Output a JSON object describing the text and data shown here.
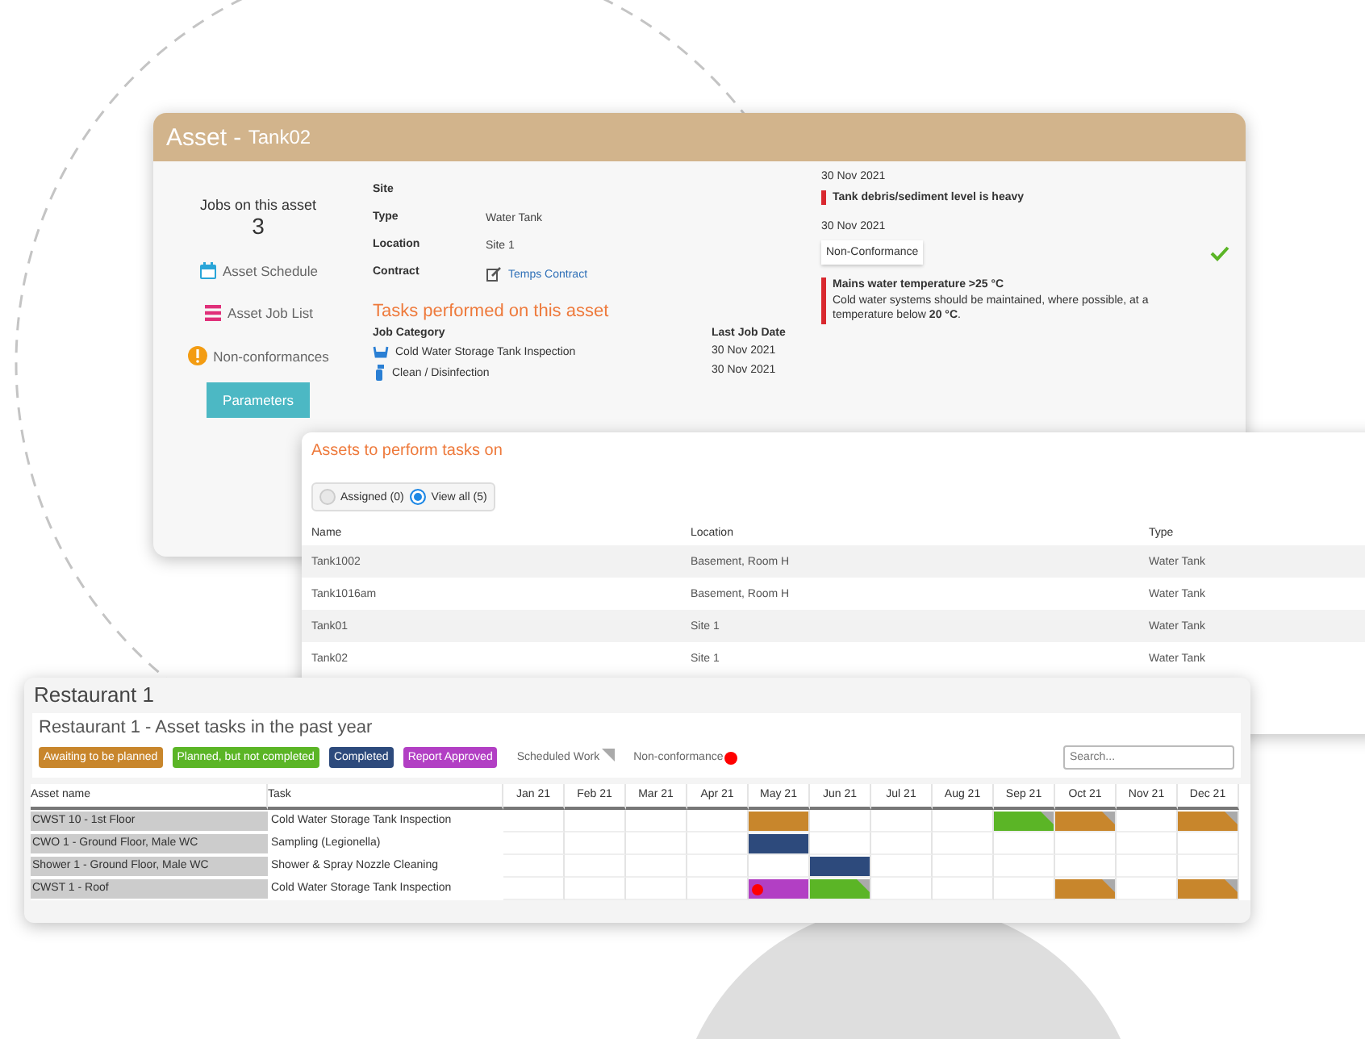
{
  "asset_window": {
    "title": "Asset -",
    "subtitle": "Tank02",
    "jobs_label": "Jobs on this asset",
    "jobs_count": "3",
    "links": [
      {
        "label": "Asset Schedule",
        "kind": "calendar"
      },
      {
        "label": "Asset Job List",
        "kind": "list"
      },
      {
        "label": "Non-conformances",
        "kind": "warning"
      }
    ],
    "button": "Parameters",
    "fields": [
      {
        "label": "Site",
        "kind": "text"
      },
      {
        "label": "Type",
        "value": "Water Tank",
        "kind": "text"
      },
      {
        "label": "Location",
        "value": "Site 1",
        "kind": "text"
      },
      {
        "label": "Contract",
        "value": "Temps Contract",
        "kind": "link"
      }
    ],
    "tasks": {
      "heading": "Tasks performed on this asset",
      "columns": [
        "Job Category",
        "Last Job Date"
      ],
      "rows": [
        {
          "category": "Cold Water Storage Tank Inspection",
          "date": "30 Nov 2021",
          "kind": "inspection"
        },
        {
          "category": "Clean / Disinfection",
          "date": "30 Nov 2021",
          "kind": "clean"
        }
      ]
    },
    "notes": [
      {
        "date": "30 Nov 2021",
        "title": "Tank debris/sediment level is heavy",
        "resolved": false
      },
      {
        "date": "30 Nov 2021",
        "badge": "Non-Conformance",
        "resolved": true,
        "title": "Mains water temperature >25 °C",
        "text": "Cold water systems should be maintained, where possible, at a temperature below **20 °C**."
      }
    ]
  },
  "assets_panel": {
    "title": "Assets to perform tasks on",
    "filters": [
      {
        "label": "Assigned (0)",
        "selected": false
      },
      {
        "label": "View all (5)",
        "selected": true
      }
    ],
    "columns": [
      "Name",
      "Location",
      "Type"
    ],
    "rows": [
      [
        "Tank1002",
        "Basement, Room H",
        "Water Tank"
      ],
      [
        "Tank1016am",
        "Basement, Room H",
        "Water Tank"
      ],
      [
        "Tank01",
        "Site 1",
        "Water Tank"
      ],
      [
        "Tank02",
        "Site 1",
        "Water Tank"
      ]
    ]
  },
  "restaurant": {
    "title": "Restaurant 1",
    "subtitle": "Restaurant 1 - Asset tasks in the past year",
    "legend": [
      {
        "label": "Awaiting to be planned",
        "color": "#c8862c"
      },
      {
        "label": "Planned, but not completed",
        "color": "#5bb526"
      },
      {
        "label": "Completed",
        "color": "#2d4a7c"
      },
      {
        "label": "Report Approved",
        "color": "#b23fc4"
      }
    ],
    "markers": [
      {
        "label": "Scheduled Work",
        "kind": "scheduled"
      },
      {
        "label": "Non-conformance",
        "kind": "nonconformance"
      }
    ],
    "search": {
      "placeholder": "Search..."
    },
    "columns": [
      "Asset name",
      "Task",
      "Jan 21",
      "Feb 21",
      "Mar 21",
      "Apr 21",
      "May 21",
      "Jun 21",
      "Jul 21",
      "Aug 21",
      "Sep 21",
      "Oct 21",
      "Nov 21",
      "Dec 21"
    ],
    "rows": [
      {
        "asset": "CWST 10 - 1st Floor",
        "task": "Cold Water Storage Tank Inspection",
        "cells": [
          {
            "scheduled": false,
            "nonconformance": false
          },
          {
            "scheduled": false,
            "nonconformance": false
          },
          {
            "scheduled": false,
            "nonconformance": false
          },
          {
            "scheduled": false,
            "nonconformance": false
          },
          {
            "color": "#c8862c",
            "scheduled": false,
            "nonconformance": false
          },
          {
            "scheduled": false,
            "nonconformance": false
          },
          {
            "scheduled": false,
            "nonconformance": false
          },
          {
            "scheduled": false,
            "nonconformance": false
          },
          {
            "color": "#5bb526",
            "scheduled": true,
            "nonconformance": false
          },
          {
            "color": "#c8862c",
            "scheduled": true,
            "nonconformance": false
          },
          {
            "scheduled": false,
            "nonconformance": false
          },
          {
            "color": "#c8862c",
            "scheduled": true,
            "nonconformance": false
          }
        ]
      },
      {
        "asset": "CWO 1 - Ground Floor, Male WC",
        "task": "Sampling (Legionella)",
        "cells": [
          {
            "scheduled": false,
            "nonconformance": false
          },
          {
            "scheduled": false,
            "nonconformance": false
          },
          {
            "scheduled": false,
            "nonconformance": false
          },
          {
            "scheduled": false,
            "nonconformance": false
          },
          {
            "color": "#2d4a7c",
            "scheduled": false,
            "nonconformance": false
          },
          {
            "scheduled": false,
            "nonconformance": false
          },
          {
            "scheduled": false,
            "nonconformance": false
          },
          {
            "scheduled": false,
            "nonconformance": false
          },
          {
            "scheduled": false,
            "nonconformance": false
          },
          {
            "scheduled": false,
            "nonconformance": false
          },
          {
            "scheduled": false,
            "nonconformance": false
          },
          {
            "scheduled": false,
            "nonconformance": false
          }
        ]
      },
      {
        "asset": "Shower 1 - Ground Floor, Male WC",
        "task": "Shower & Spray Nozzle Cleaning",
        "cells": [
          {
            "scheduled": false,
            "nonconformance": false
          },
          {
            "scheduled": false,
            "nonconformance": false
          },
          {
            "scheduled": false,
            "nonconformance": false
          },
          {
            "scheduled": false,
            "nonconformance": false
          },
          {
            "scheduled": false,
            "nonconformance": false
          },
          {
            "color": "#2d4a7c",
            "scheduled": false,
            "nonconformance": false
          },
          {
            "scheduled": false,
            "nonconformance": false
          },
          {
            "scheduled": false,
            "nonconformance": false
          },
          {
            "scheduled": false,
            "nonconformance": false
          },
          {
            "scheduled": false,
            "nonconformance": false
          },
          {
            "scheduled": false,
            "nonconformance": false
          },
          {
            "scheduled": false,
            "nonconformance": false
          }
        ]
      },
      {
        "asset": "CWST 1 - Roof",
        "task": "Cold Water Storage Tank Inspection",
        "cells": [
          {
            "scheduled": false,
            "nonconformance": false
          },
          {
            "scheduled": false,
            "nonconformance": false
          },
          {
            "scheduled": false,
            "nonconformance": false
          },
          {
            "scheduled": false,
            "nonconformance": false
          },
          {
            "color": "#b23fc4",
            "scheduled": false,
            "nonconformance": true
          },
          {
            "color": "#5bb526",
            "scheduled": true,
            "nonconformance": false
          },
          {
            "scheduled": false,
            "nonconformance": false
          },
          {
            "scheduled": false,
            "nonconformance": false
          },
          {
            "scheduled": false,
            "nonconformance": false
          },
          {
            "color": "#c8862c",
            "scheduled": true,
            "nonconformance": false
          },
          {
            "scheduled": false,
            "nonconformance": false
          },
          {
            "color": "#c8862c",
            "scheduled": true,
            "nonconformance": false
          }
        ]
      }
    ]
  }
}
